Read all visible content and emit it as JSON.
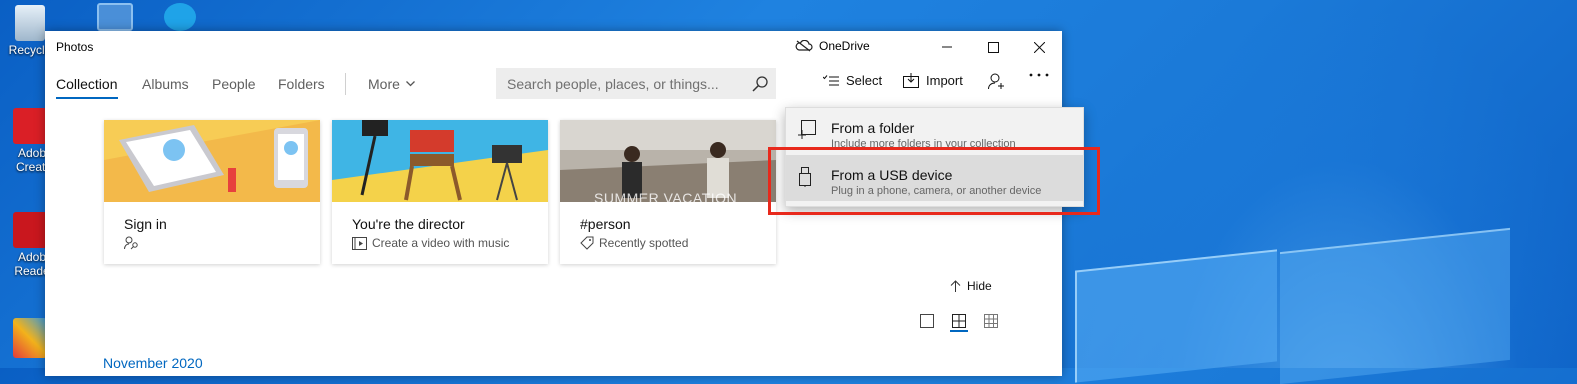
{
  "desktop": {
    "icons": [
      {
        "label": "Recycle",
        "icon": "recycle-bin-icon"
      },
      {
        "label": "Adob\nCreati",
        "icon": "adobe-creative-cloud-icon"
      },
      {
        "label": "Adob\nReade",
        "icon": "adobe-reader-icon"
      }
    ]
  },
  "window": {
    "title": "Photos",
    "onedrive_label": "OneDrive"
  },
  "nav": {
    "tabs": [
      "Collection",
      "Albums",
      "People",
      "Folders"
    ],
    "active_tab": "Collection",
    "more_label": "More"
  },
  "search": {
    "placeholder": "Search people, places, or things..."
  },
  "toolbar": {
    "select_label": "Select",
    "import_label": "Import"
  },
  "cards": [
    {
      "title": "Sign in",
      "subtitle": "",
      "icon": "person-key-icon"
    },
    {
      "title": "You're the director",
      "subtitle": "Create a video with music",
      "icon": "video-editor-icon"
    },
    {
      "title": "#person",
      "subtitle": "Recently spotted",
      "icon": "tag-icon",
      "overlay": "SUMMER VACATION"
    }
  ],
  "import_menu": {
    "items": [
      {
        "title": "From a folder",
        "subtitle": "Include more folders in your collection",
        "icon": "folder-add-icon"
      },
      {
        "title": "From a USB device",
        "subtitle": "Plug in a phone, camera, or another device",
        "icon": "usb-icon",
        "highlighted": true
      }
    ]
  },
  "hide_label": "Hide",
  "view_modes": [
    "single-view-icon",
    "grid-medium-icon",
    "grid-small-icon"
  ],
  "month_label": "November 2020",
  "colors": {
    "accent": "#0067c0",
    "highlight_box": "#e8291c",
    "desktop_blue": "#1b7ad8"
  }
}
